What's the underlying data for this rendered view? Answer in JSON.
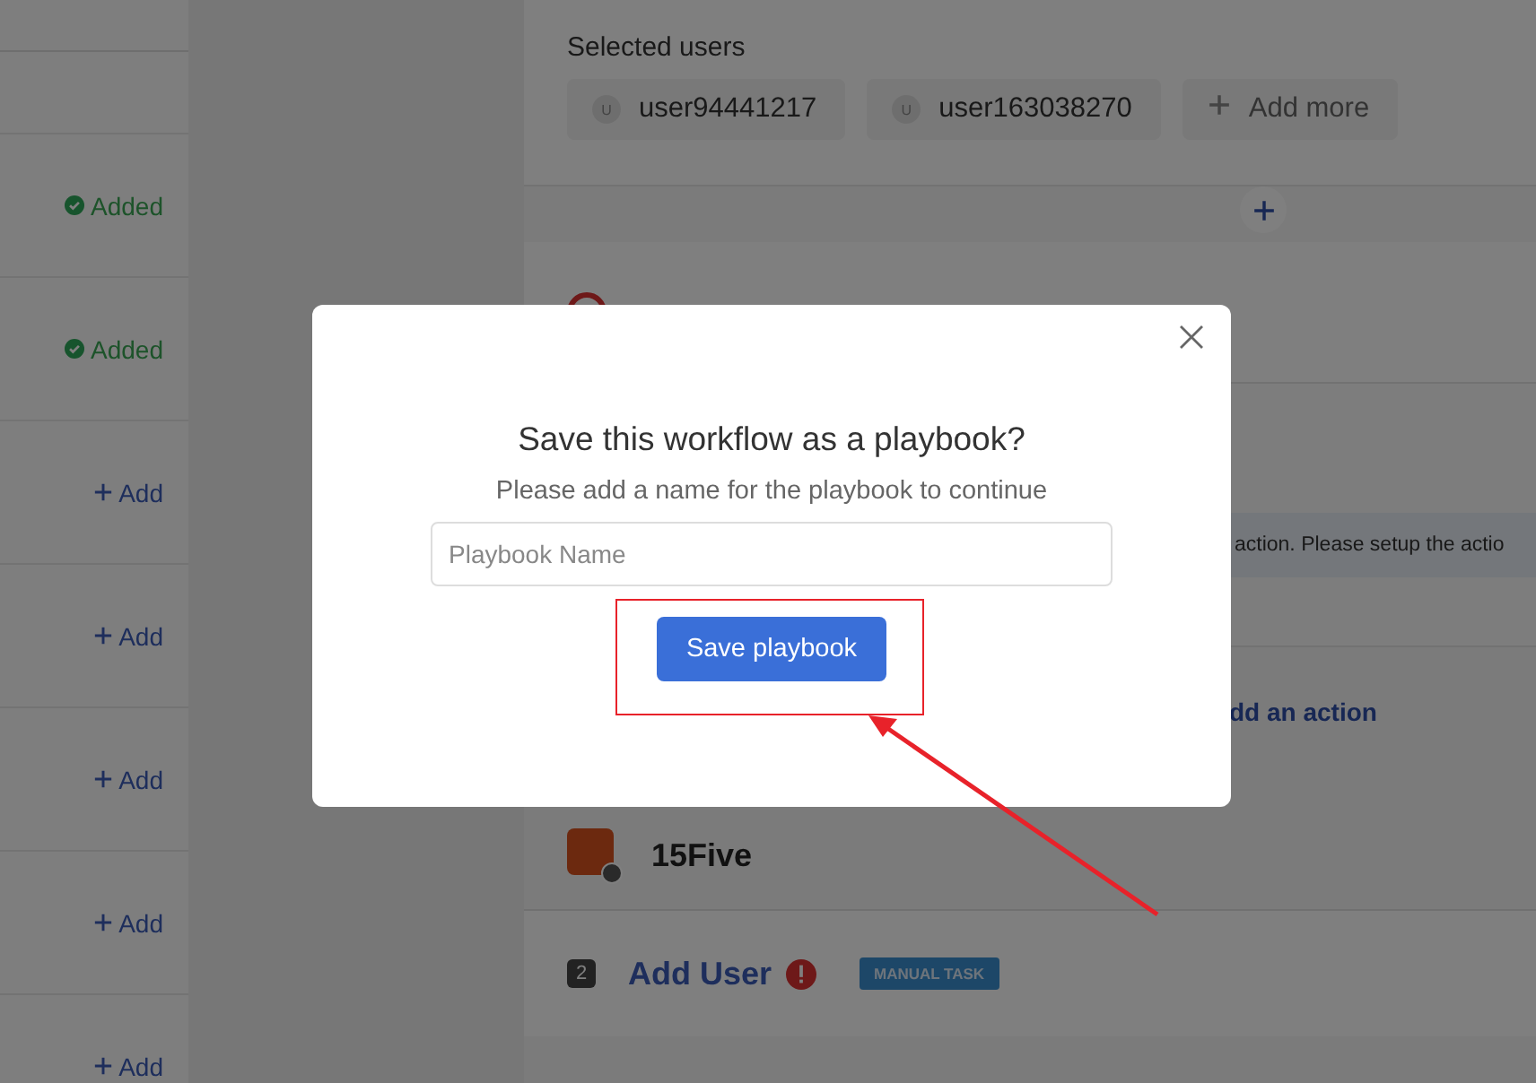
{
  "integrations": [
    {
      "status": "Added",
      "added": true
    },
    {
      "status": "Added",
      "added": true
    },
    {
      "status": "Add",
      "added": false
    },
    {
      "status": "Add",
      "added": false
    },
    {
      "status": "Add",
      "added": false
    },
    {
      "status": "Add",
      "added": false
    },
    {
      "status": "Add",
      "added": false
    }
  ],
  "selected_users": {
    "label": "Selected users",
    "users": [
      {
        "initial": "U",
        "name": "user94441217"
      },
      {
        "initial": "U",
        "name": "user163038270"
      }
    ],
    "add_more": "Add more"
  },
  "workflow": {
    "notice": "action. Please setup the actio",
    "add_action": "dd an action",
    "app": {
      "name": "15Five"
    },
    "step": {
      "number": "2",
      "title": "Add User",
      "tag": "MANUAL TASK"
    }
  },
  "dialog": {
    "title": "Save this workflow as a playbook?",
    "subtitle": "Please add a name for the playbook to continue",
    "placeholder": "Playbook Name",
    "button": "Save playbook"
  }
}
